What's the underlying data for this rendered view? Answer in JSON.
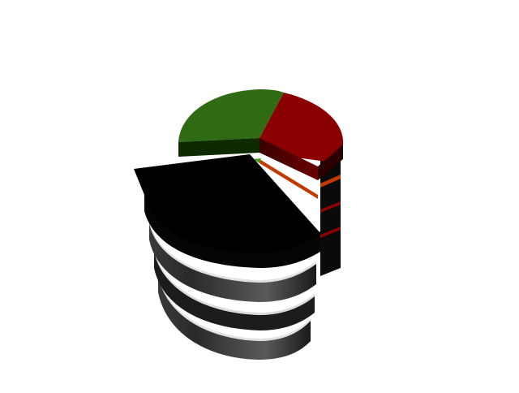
{
  "chart_data": {
    "type": "pie",
    "subtype": "stacked-3d-exploded",
    "layers": 4,
    "slices": [
      {
        "index": 0,
        "value": 17,
        "color": "#2e6b12",
        "exploded": false
      },
      {
        "index": 1,
        "value": 22,
        "color": "#8a0000",
        "exploded": false
      },
      {
        "index": 2,
        "value": 61,
        "color": "#000000",
        "exploded": true
      }
    ],
    "title": "",
    "legend": "none"
  }
}
